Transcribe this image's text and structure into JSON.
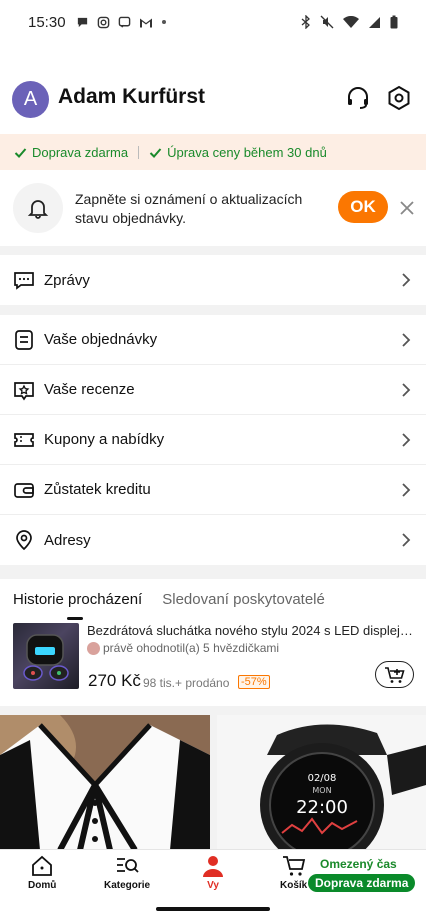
{
  "status_bar": {
    "time": "15:30"
  },
  "header": {
    "avatar_letter": "A",
    "user_name": "Adam Kurfürst"
  },
  "promo": {
    "free_shipping": "Doprava zdarma",
    "price_adjust": "Úprava ceny během 30 dnů"
  },
  "notification": {
    "text": "Zapněte si oznámení o aktualizacích stavu objednávky.",
    "ok_label": "OK"
  },
  "menu": {
    "messages": "Zprávy",
    "orders": "Vaše objednávky",
    "reviews": "Vaše recenze",
    "coupons": "Kupony a nabídky",
    "credit": "Zůstatek kreditu",
    "addresses": "Adresy"
  },
  "history": {
    "tab_browsing": "Historie procházení",
    "tab_followed": "Sledovaní poskytovatelé",
    "product": {
      "title": "Bezdrátová sluchátka nového stylu 2024 s LED displejem",
      "review": "právě ohodnotil(a) 5 hvězdičkami",
      "price": "270 Kč",
      "sold": "98 tis.+ prodáno",
      "discount": "-57%"
    }
  },
  "watch_screen": {
    "date": "02/08",
    "day": "MON",
    "time": "22:00"
  },
  "bottom_nav": {
    "home": "Domů",
    "categories": "Kategorie",
    "you": "Vy",
    "cart": "Košík",
    "limited_time": "Omezený čas",
    "free_shipping": "Doprava zdarma"
  },
  "colors": {
    "accent": "#fb7701",
    "green": "#1a8a2b",
    "active_nav": "#e02e24",
    "avatar": "#6b62b8"
  }
}
